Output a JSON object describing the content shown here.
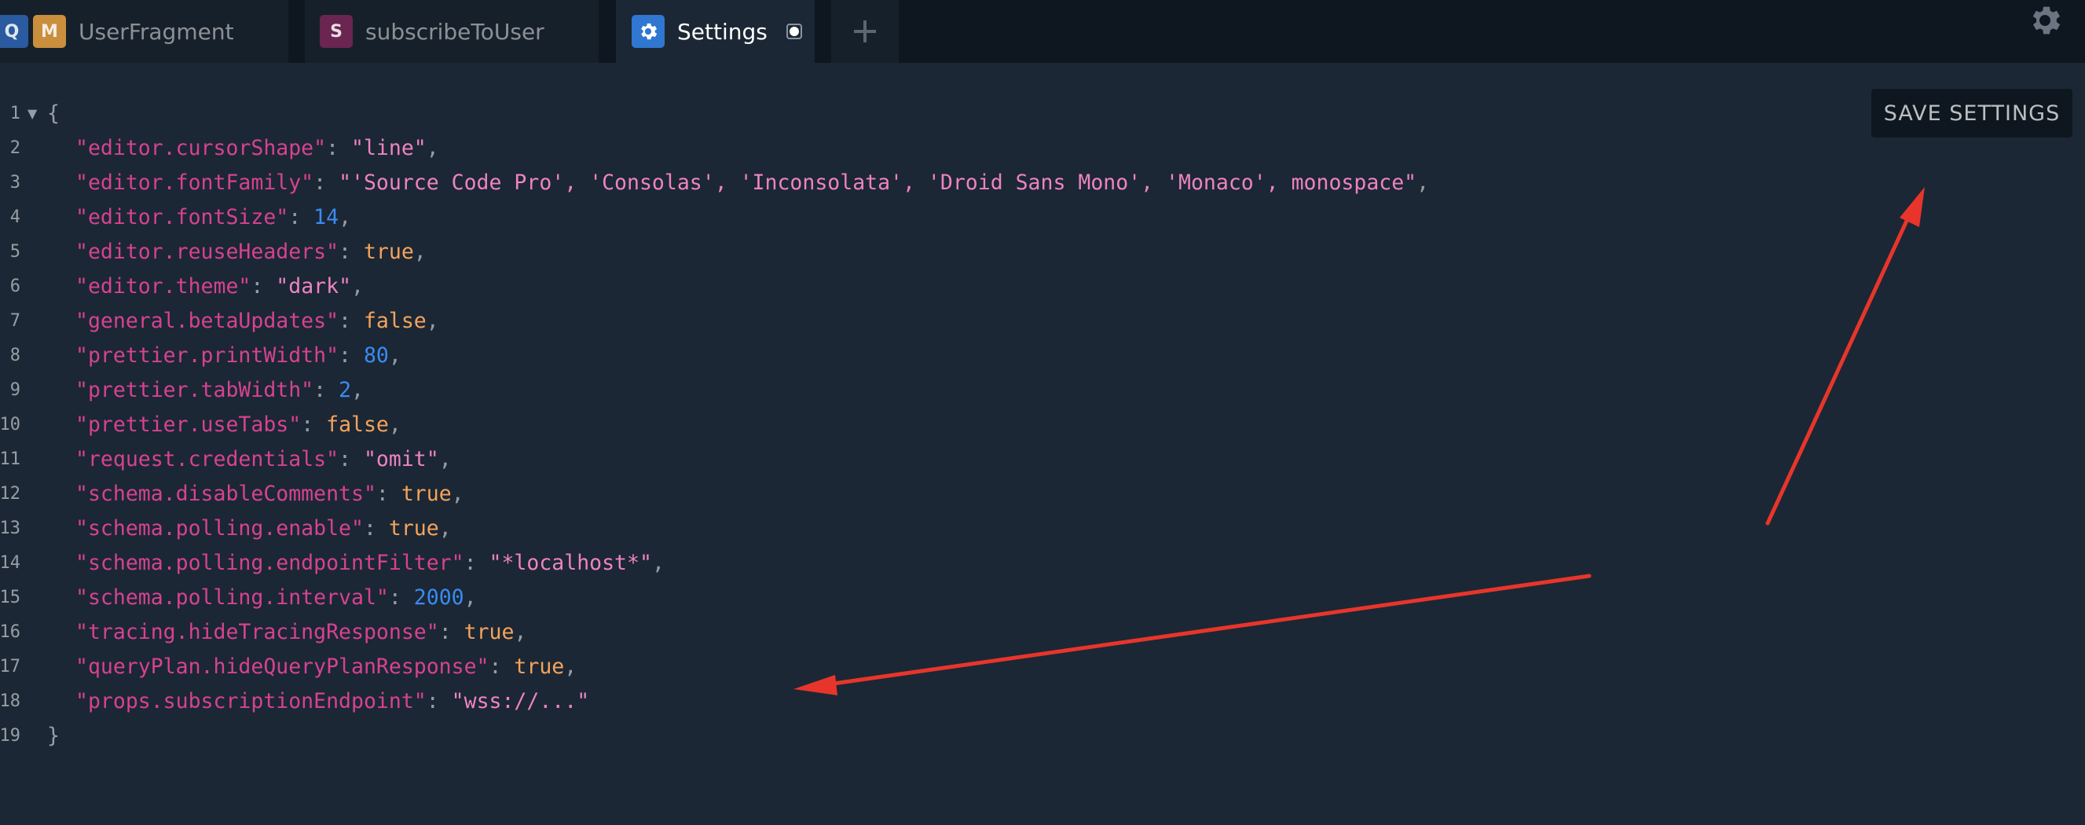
{
  "tabs": [
    {
      "badges": [
        "Q",
        "M"
      ],
      "label": "UserFragment",
      "active": false
    },
    {
      "badges": [
        "S"
      ],
      "label": "subscribeToUser",
      "active": false
    },
    {
      "icon": "gear-icon",
      "label": "Settings",
      "active": true,
      "unsaved": true
    }
  ],
  "add_tab_icon": "plus-icon",
  "settings_icon": "gear-icon",
  "save_button": {
    "label": "SAVE SETTINGS"
  },
  "editor": {
    "open_brace": "{",
    "close_brace": "}",
    "fold_icon": "fold-triangle-icon",
    "lines": [
      {
        "number": "1"
      },
      {
        "number": "2",
        "key": "\"editor.cursorShape\"",
        "value": "\"line\"",
        "type": "string"
      },
      {
        "number": "3",
        "key": "\"editor.fontFamily\"",
        "value": "\"'Source Code Pro', 'Consolas', 'Inconsolata', 'Droid Sans Mono', 'Monaco', monospace\"",
        "type": "string"
      },
      {
        "number": "4",
        "key": "\"editor.fontSize\"",
        "value": "14",
        "type": "number"
      },
      {
        "number": "5",
        "key": "\"editor.reuseHeaders\"",
        "value": "true",
        "type": "boolean"
      },
      {
        "number": "6",
        "key": "\"editor.theme\"",
        "value": "\"dark\"",
        "type": "string"
      },
      {
        "number": "7",
        "key": "\"general.betaUpdates\"",
        "value": "false",
        "type": "boolean"
      },
      {
        "number": "8",
        "key": "\"prettier.printWidth\"",
        "value": "80",
        "type": "number"
      },
      {
        "number": "9",
        "key": "\"prettier.tabWidth\"",
        "value": "2",
        "type": "number"
      },
      {
        "number": "10",
        "key": "\"prettier.useTabs\"",
        "value": "false",
        "type": "boolean"
      },
      {
        "number": "11",
        "key": "\"request.credentials\"",
        "value": "\"omit\"",
        "type": "string"
      },
      {
        "number": "12",
        "key": "\"schema.disableComments\"",
        "value": "true",
        "type": "boolean"
      },
      {
        "number": "13",
        "key": "\"schema.polling.enable\"",
        "value": "true",
        "type": "boolean"
      },
      {
        "number": "14",
        "key": "\"schema.polling.endpointFilter\"",
        "value": "\"*localhost*\"",
        "type": "string"
      },
      {
        "number": "15",
        "key": "\"schema.polling.interval\"",
        "value": "2000",
        "type": "number"
      },
      {
        "number": "16",
        "key": "\"tracing.hideTracingResponse\"",
        "value": "true",
        "type": "boolean"
      },
      {
        "number": "17",
        "key": "\"queryPlan.hideQueryPlanResponse\"",
        "value": "true",
        "type": "boolean"
      },
      {
        "number": "18",
        "key": "\"props.subscriptionEndpoint\"",
        "value": "\"wss://...\"",
        "type": "string"
      },
      {
        "number": "19"
      }
    ]
  },
  "colors": {
    "background": "#1b2734",
    "tabbar": "#0e1720",
    "key": "#d64292",
    "string": "#ee83c2",
    "boolean": "#f5a35c",
    "number": "#3a8bf2",
    "annotation_arrow": "#e8352b"
  }
}
